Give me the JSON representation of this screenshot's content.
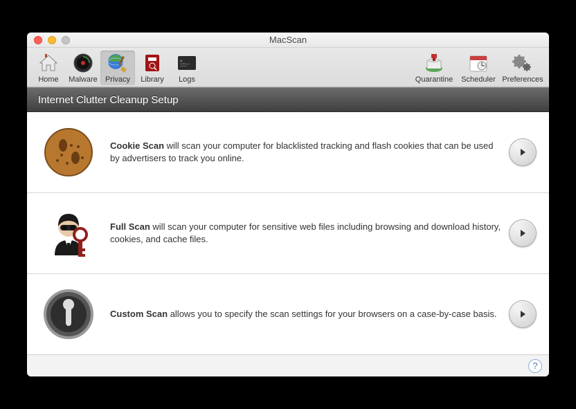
{
  "window": {
    "title": "MacScan"
  },
  "toolbar": {
    "left": [
      {
        "id": "home",
        "label": "Home"
      },
      {
        "id": "malware",
        "label": "Malware"
      },
      {
        "id": "privacy",
        "label": "Privacy",
        "selected": true
      },
      {
        "id": "library",
        "label": "Library"
      },
      {
        "id": "logs",
        "label": "Logs"
      }
    ],
    "right": [
      {
        "id": "quarantine",
        "label": "Quarantine"
      },
      {
        "id": "scheduler",
        "label": "Scheduler"
      },
      {
        "id": "preferences",
        "label": "Preferences"
      }
    ]
  },
  "banner": {
    "title": "Internet Clutter Cleanup Setup"
  },
  "scans": [
    {
      "id": "cookie",
      "title": "Cookie Scan",
      "desc": " will scan your computer for blacklisted tracking and flash cookies that can be used by advertisers to track you online."
    },
    {
      "id": "full",
      "title": "Full Scan",
      "desc": " will scan your computer for sensitive web files including browsing and download history, cookies, and cache files."
    },
    {
      "id": "custom",
      "title": "Custom Scan",
      "desc": " allows you to specify the scan settings for your browsers on a case-by-case basis."
    }
  ],
  "help": {
    "glyph": "?"
  }
}
